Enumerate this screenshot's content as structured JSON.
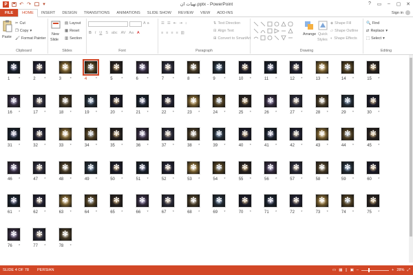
{
  "window": {
    "title": "تهیات ان.pptx - PowerPoint",
    "controls": [
      "?",
      "▭",
      "–",
      "▢",
      "✕"
    ]
  },
  "quick_access": [
    "save-icon",
    "undo-icon",
    "redo-icon",
    "start-from-beginning-icon",
    "customize-icon"
  ],
  "tabs": [
    {
      "label": "FILE",
      "kind": "file"
    },
    {
      "label": "HOME",
      "kind": "active"
    },
    {
      "label": "INSERT"
    },
    {
      "label": "DESIGN"
    },
    {
      "label": "TRANSITIONS"
    },
    {
      "label": "ANIMATIONS"
    },
    {
      "label": "SLIDE SHOW"
    },
    {
      "label": "REVIEW"
    },
    {
      "label": "VIEW"
    },
    {
      "label": "ADD-INS"
    }
  ],
  "signin": "Sign in",
  "ribbon": {
    "clipboard": {
      "label": "Clipboard",
      "paste": "Paste",
      "cut": "Cut",
      "copy": "Copy",
      "format_painter": "Format Painter"
    },
    "slides": {
      "label": "Slides",
      "new_slide_1": "New",
      "new_slide_2": "Slide",
      "layout": "Layout",
      "reset": "Reset",
      "section": "Section"
    },
    "font": {
      "label": "Font"
    },
    "paragraph": {
      "label": "Paragraph",
      "text_direction": "Text Direction",
      "align_text": "Align Text",
      "convert": "Convert to SmartArt"
    },
    "drawing": {
      "label": "Drawing",
      "arrange": "Arrange",
      "quick_styles_1": "Quick",
      "quick_styles_2": "Styles",
      "shape_fill": "Shape Fill",
      "shape_outline": "Shape Outline",
      "shape_effects": "Shape Effects"
    },
    "editing": {
      "label": "Editing",
      "find": "Find",
      "replace": "Replace",
      "select": "Select"
    }
  },
  "slides": {
    "total": 78,
    "selected": 4,
    "numbers": [
      "1",
      "2",
      "3",
      "4",
      "5",
      "6",
      "7",
      "8",
      "9",
      "10",
      "11",
      "12",
      "13",
      "14",
      "15",
      "16",
      "17",
      "18",
      "19",
      "20",
      "21",
      "22",
      "23",
      "24",
      "25",
      "26",
      "27",
      "28",
      "29",
      "30",
      "31",
      "32",
      "33",
      "34",
      "35",
      "36",
      "37",
      "38",
      "39",
      "40",
      "41",
      "42",
      "43",
      "44",
      "45",
      "46",
      "47",
      "48",
      "49",
      "50",
      "51",
      "52",
      "53",
      "54",
      "55",
      "56",
      "57",
      "58",
      "59",
      "60",
      "61",
      "62",
      "63",
      "64",
      "65",
      "66",
      "67",
      "68",
      "69",
      "70",
      "71",
      "72",
      "73",
      "74",
      "75",
      "76",
      "77",
      "78"
    ],
    "star_marker": "*",
    "colors": [
      "#2b2b49",
      "#3a2f2a",
      "#6b5633",
      "#1d2a3d",
      "#7b5f2c",
      "#3c3c56",
      "#22223a",
      "#c59a46",
      "#4d3e5f",
      "#2f3f4f"
    ]
  },
  "status": {
    "slide_info": "SLIDE 4 OF 78",
    "language": "PERSIAN",
    "zoom": "28%"
  }
}
